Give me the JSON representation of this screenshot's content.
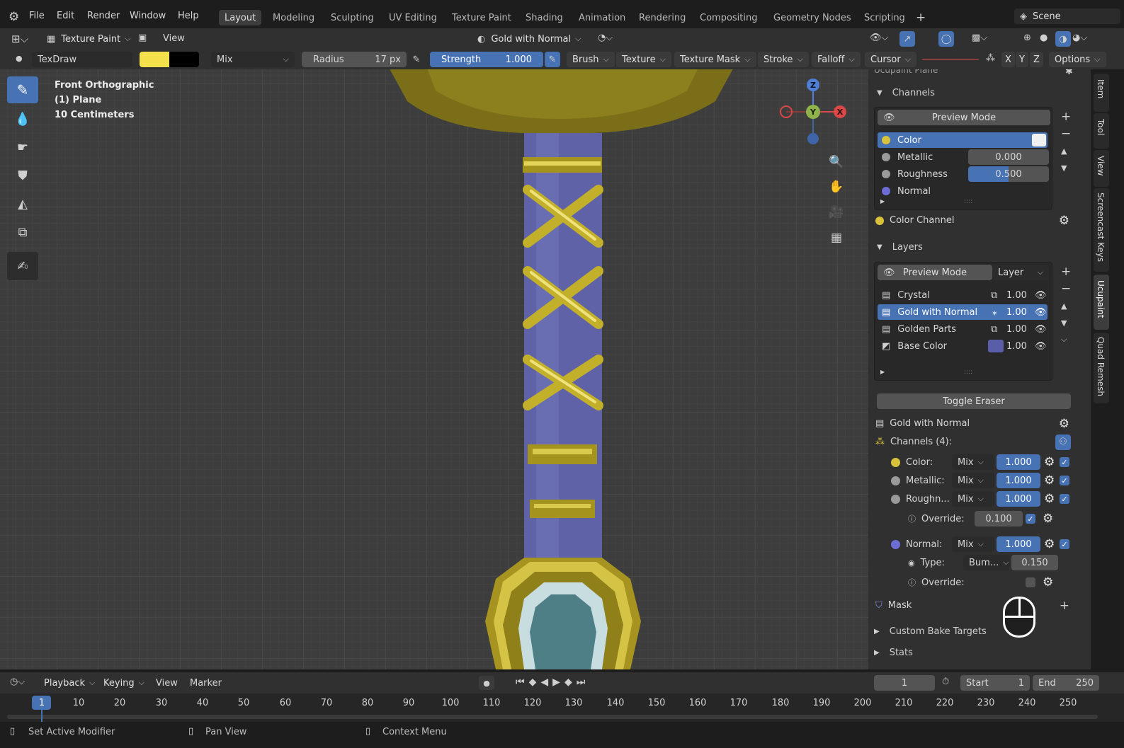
{
  "menu": {
    "items": [
      "File",
      "Edit",
      "Render",
      "Window",
      "Help"
    ],
    "workspaces": [
      "Layout",
      "Modeling",
      "Sculpting",
      "UV Editing",
      "Texture Paint",
      "Shading",
      "Animation",
      "Rendering",
      "Compositing",
      "Geometry Nodes",
      "Scripting"
    ],
    "active_workspace": "Layout",
    "scene": "Scene"
  },
  "header": {
    "mode": "Texture Paint",
    "view": "View",
    "material": "Gold with Normal"
  },
  "toolsettings": {
    "brush": "TexDraw",
    "blend": "Mix",
    "radius_label": "Radius",
    "radius_value": "17 px",
    "strength_label": "Strength",
    "strength_value": "1.000",
    "menus": [
      "Brush",
      "Texture",
      "Texture Mask",
      "Stroke",
      "Falloff",
      "Cursor"
    ],
    "axes": [
      "X",
      "Y",
      "Z"
    ],
    "options": "Options",
    "color_primary": "#f4e04a",
    "color_secondary": "#000000"
  },
  "viewport": {
    "line1": "Front Orthographic",
    "line2": "(1) Plane",
    "line3": "10 Centimeters",
    "gizmo": {
      "z": "Z",
      "y": "Y",
      "x": "X"
    }
  },
  "sidebar": {
    "tabs": [
      "Item",
      "Tool",
      "View",
      "Screencast Keys",
      "Ucupaint",
      "Quad Remesh"
    ],
    "top_cut": "Ucupaint Plane",
    "channels_title": "Channels",
    "preview_mode": "Preview Mode",
    "channels": [
      {
        "name": "Color",
        "value": "",
        "color": "#d8c23c"
      },
      {
        "name": "Metallic",
        "value": "0.000",
        "color": "#9a9a9a"
      },
      {
        "name": "Roughness",
        "value": "0.500",
        "color": "#9a9a9a"
      },
      {
        "name": "Normal",
        "value": "",
        "color": "#6d6dd6"
      }
    ],
    "color_channel": "Color Channel",
    "layers_title": "Layers",
    "layers_preview": "Preview Mode",
    "layers_dropdown": "Layer",
    "layers": [
      {
        "name": "Crystal",
        "value": "1.00"
      },
      {
        "name": "Gold with Normal",
        "value": "1.00"
      },
      {
        "name": "Golden Parts",
        "value": "1.00"
      },
      {
        "name": "Base Color",
        "value": "1.00"
      }
    ],
    "toggle_eraser": "Toggle Eraser",
    "active_layer": "Gold with Normal",
    "channels_count": "Channels (4):",
    "layer_channels": [
      {
        "name": "Color:",
        "blend": "Mix",
        "value": "1.000"
      },
      {
        "name": "Metallic:",
        "blend": "Mix",
        "value": "1.000"
      },
      {
        "name": "Roughn...",
        "blend": "Mix",
        "value": "1.000"
      }
    ],
    "override_label": "Override:",
    "override_value": "0.100",
    "normal_channel": {
      "name": "Normal:",
      "blend": "Mix",
      "value": "1.000"
    },
    "type_label": "Type:",
    "type_value": "Bum...",
    "type_number": "0.150",
    "override2_label": "Override:",
    "mask": "Mask",
    "custom_bake": "Custom Bake Targets",
    "stats": "Stats"
  },
  "timeline": {
    "menus": [
      "Playback",
      "Keying",
      "View",
      "Marker"
    ],
    "current_frame": "1",
    "start_label": "Start",
    "start_value": "1",
    "end_label": "End",
    "end_value": "250",
    "ticks": [
      "1",
      "10",
      "20",
      "30",
      "40",
      "50",
      "60",
      "70",
      "80",
      "90",
      "100",
      "110",
      "120",
      "130",
      "140",
      "150",
      "160",
      "170",
      "180",
      "190",
      "200",
      "210",
      "220",
      "230",
      "240",
      "250"
    ]
  },
  "statusbar": {
    "items": [
      "Set Active Modifier",
      "Pan View",
      "Context Menu"
    ]
  }
}
